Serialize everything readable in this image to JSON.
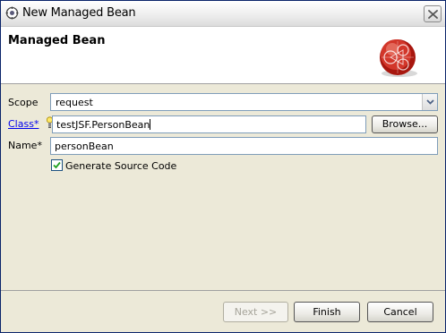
{
  "window": {
    "title": "New Managed Bean"
  },
  "header": {
    "title": "Managed Bean"
  },
  "form": {
    "scope": {
      "label": "Scope",
      "value": "request"
    },
    "class": {
      "label": "Class*",
      "value": "testJSF.PersonBean",
      "browse_label": "Browse..."
    },
    "name": {
      "label": "Name*",
      "value": "personBean"
    },
    "generate_source": {
      "label": "Generate Source Code",
      "checked": true
    }
  },
  "footer": {
    "next_label": "Next >>",
    "finish_label": "Finish",
    "cancel_label": "Cancel"
  },
  "colors": {
    "link": "#0000ee",
    "dialog_bg": "#ece9d8",
    "logo_red": "#c0281e",
    "field_border": "#7f9db9"
  },
  "icons": [
    "app-icon",
    "close-icon",
    "managed-bean-logo",
    "dropdown-arrow-icon",
    "lightbulb-icon",
    "checkmark-icon"
  ]
}
